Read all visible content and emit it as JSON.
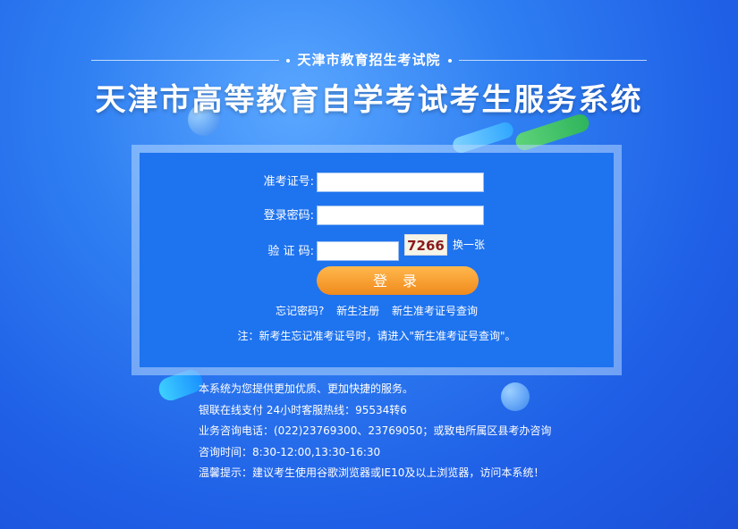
{
  "header": {
    "org": "天津市教育招生考试院",
    "title": "天津市高等教育自学考试考生服务系统"
  },
  "form": {
    "ticket_label": "准考证号:",
    "ticket_value": "",
    "password_label": "登录密码:",
    "password_value": "",
    "captcha_label": "验 证 码:",
    "captcha_value": "",
    "captcha_image_text": "7266",
    "captcha_refresh": "换一张",
    "login_button": "登 录"
  },
  "links": {
    "forgot_password": "忘记密码?",
    "new_register": "新生注册",
    "ticket_query": "新生准考证号查询"
  },
  "note": "注：新考生忘记准考证号时，请进入\"新生准考证号查询\"。",
  "info": [
    "本系统为您提供更加优质、更加快捷的服务。",
    "银联在线支付 24小时客服热线：95534转6",
    "业务咨询电话：(022)23769300、23769050；或致电所属区县考办咨询",
    "咨询时间：8:30-12:00,13:30-16:30",
    "温馨提示：建议考生使用谷歌浏览器或IE10及以上浏览器，访问本系统！"
  ],
  "colors": {
    "background": "#2f7ff2",
    "panel": "#1e73ef",
    "login_button": "#f5a030"
  }
}
